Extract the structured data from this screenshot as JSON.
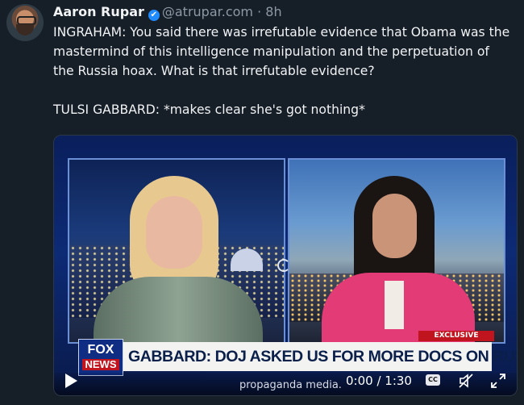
{
  "post": {
    "author_name": "Aaron Rupar",
    "verified_mark": "✔",
    "handle": "@atrupar.com",
    "separator": " · ",
    "time": "8h",
    "paragraphs": [
      "INGRAHAM: You said there was irrefutable evidence that Obama was the mastermind of this intelligence manipulation and the perpetuation of the Russia hoax. What is that irrefutable evidence?",
      "TULSI GABBARD: *makes clear she's got nothing*"
    ]
  },
  "video": {
    "badge": "EXCLUSIVE",
    "logo_line1": "FOX",
    "logo_line2": "NEWS",
    "chyron": "GABBARD: DOJ ASKED US FOR MORE DOCS ON RUSSIA HOAX",
    "ticker": "propaganda media.",
    "time_display": "0:00 / 1:30",
    "cc_label": "CC",
    "icons": [
      "play-icon",
      "captions-icon",
      "mute-icon",
      "fullscreen-icon",
      "loading-spinner-icon"
    ]
  },
  "colors": {
    "background": "#161e27",
    "verified": "#208bfe",
    "handle": "#8d99a6",
    "chyron_text": "#0a1f4a",
    "exclusive_red": "#c0151f"
  }
}
